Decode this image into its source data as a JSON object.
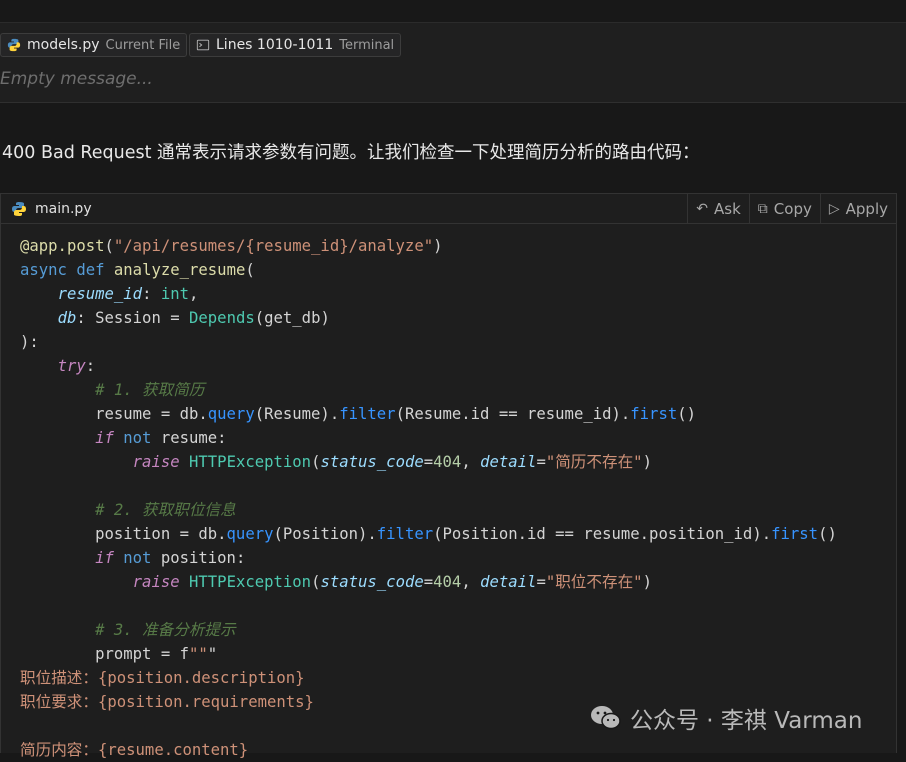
{
  "context_chips": [
    {
      "file": "models.py",
      "sub": "Current File",
      "icon": "python-file-icon"
    },
    {
      "file": "Lines 1010-1011",
      "sub": "Terminal",
      "icon": "terminal-icon"
    }
  ],
  "composer": {
    "placeholder": "Empty message..."
  },
  "answer_text": "400 Bad Request 通常表示请求参数有问题。让我们检查一下处理简历分析的路由代码：",
  "code_block": {
    "filename": "main.py",
    "actions": [
      {
        "label": "Ask",
        "icon": "undo-arrow-icon"
      },
      {
        "label": "Copy",
        "icon": "copy-icon"
      },
      {
        "label": "Apply",
        "icon": "play-icon"
      }
    ],
    "lines": [
      "@app.post(\"/api/resumes/{resume_id}/analyze\")",
      "async def analyze_resume(",
      "    resume_id: int,",
      "    db: Session = Depends(get_db)",
      "):",
      "    try:",
      "        # 1. 获取简历",
      "        resume = db.query(Resume).filter(Resume.id == resume_id).first()",
      "        if not resume:",
      "            raise HTTPException(status_code=404, detail=\"简历不存在\")",
      "",
      "        # 2. 获取职位信息",
      "        position = db.query(Position).filter(Position.id == resume.position_id).first()",
      "        if not position:",
      "            raise HTTPException(status_code=404, detail=\"职位不存在\")",
      "",
      "        # 3. 准备分析提示",
      "        prompt = f\"\"\"",
      "职位描述：{position.description}",
      "职位要求：{position.requirements}",
      "",
      "简历内容：{resume.content}"
    ]
  },
  "watermark": {
    "text": "公众号 · 李祺 Varman",
    "icon": "wechat-icon"
  },
  "colors": {
    "background": "#181818",
    "code_bg": "#1e1e1e",
    "keyword": "#569cd6",
    "string": "#ce9178",
    "comment": "#6a9955"
  }
}
